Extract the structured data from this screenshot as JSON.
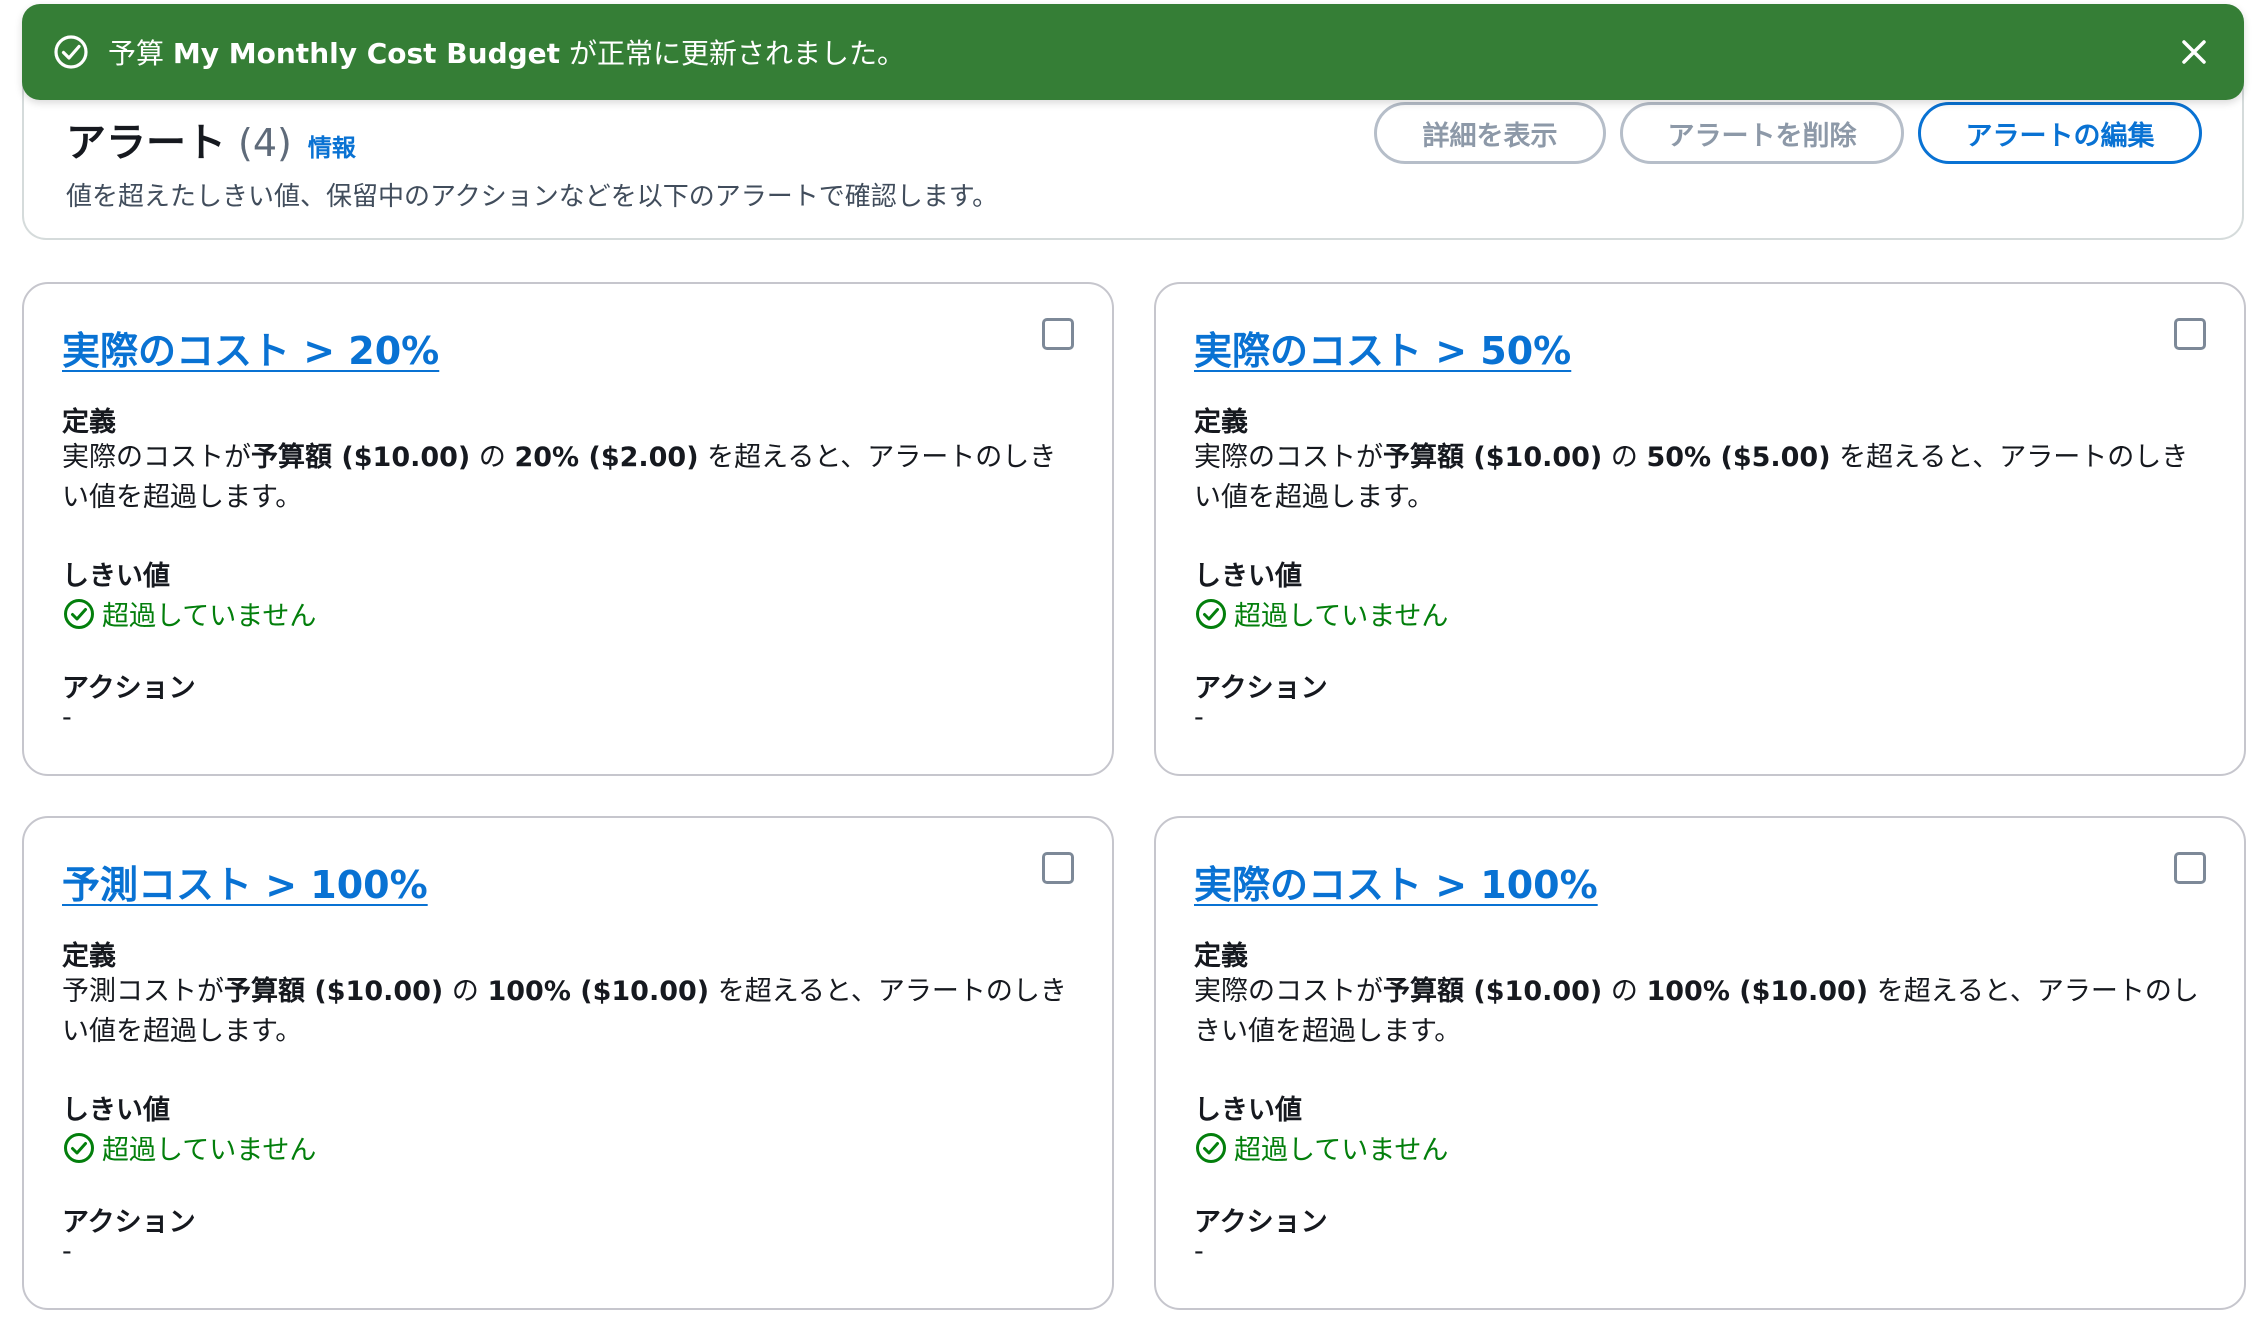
{
  "flash": {
    "prefix": "予算 ",
    "budget_name": "My Monthly Cost Budget",
    "suffix": " が正常に更新されました。",
    "color": "#357e36"
  },
  "header": {
    "title": "アラート",
    "count": "(4)",
    "info": "情報",
    "description": "値を超えたしきい値、保留中のアクションなどを以下のアラートで確認します。",
    "buttons": {
      "view_details": "詳細を表示",
      "delete_alert": "アラートを削除",
      "edit_alert": "アラートの編集"
    }
  },
  "labels": {
    "definition": "定義",
    "threshold": "しきい値",
    "actions": "アクション"
  },
  "cards": [
    {
      "title": "実際のコスト > 20%",
      "def_prefix": "実際のコストが",
      "def_budget": "予算額 ($10.00)",
      "def_mid": " の ",
      "def_amount": "20% ($2.00)",
      "def_suffix": " を超えると、アラートのしきい値を超過します。",
      "status": "超過していません",
      "action": "-"
    },
    {
      "title": "実際のコスト > 50%",
      "def_prefix": "実際のコストが",
      "def_budget": "予算額 ($10.00)",
      "def_mid": " の ",
      "def_amount": "50% ($5.00)",
      "def_suffix": " を超えると、アラートのしきい値を超過します。",
      "status": "超過していません",
      "action": "-"
    },
    {
      "title": "予測コスト > 100%",
      "def_prefix": "予測コストが",
      "def_budget": "予算額 ($10.00)",
      "def_mid": " の ",
      "def_amount": "100% ($10.00)",
      "def_suffix": " を超えると、アラートのしきい値を超過します。",
      "status": "超過していません",
      "action": "-"
    },
    {
      "title": "実際のコスト > 100%",
      "def_prefix": "実際のコストが",
      "def_budget": "予算額 ($10.00)",
      "def_mid": " の ",
      "def_amount": "100% ($10.00)",
      "def_suffix": " を超えると、アラートのしきい値を超過します。",
      "status": "超過していません",
      "action": "-"
    }
  ],
  "colors": {
    "link": "#0972d3",
    "success": "#037f0c"
  }
}
